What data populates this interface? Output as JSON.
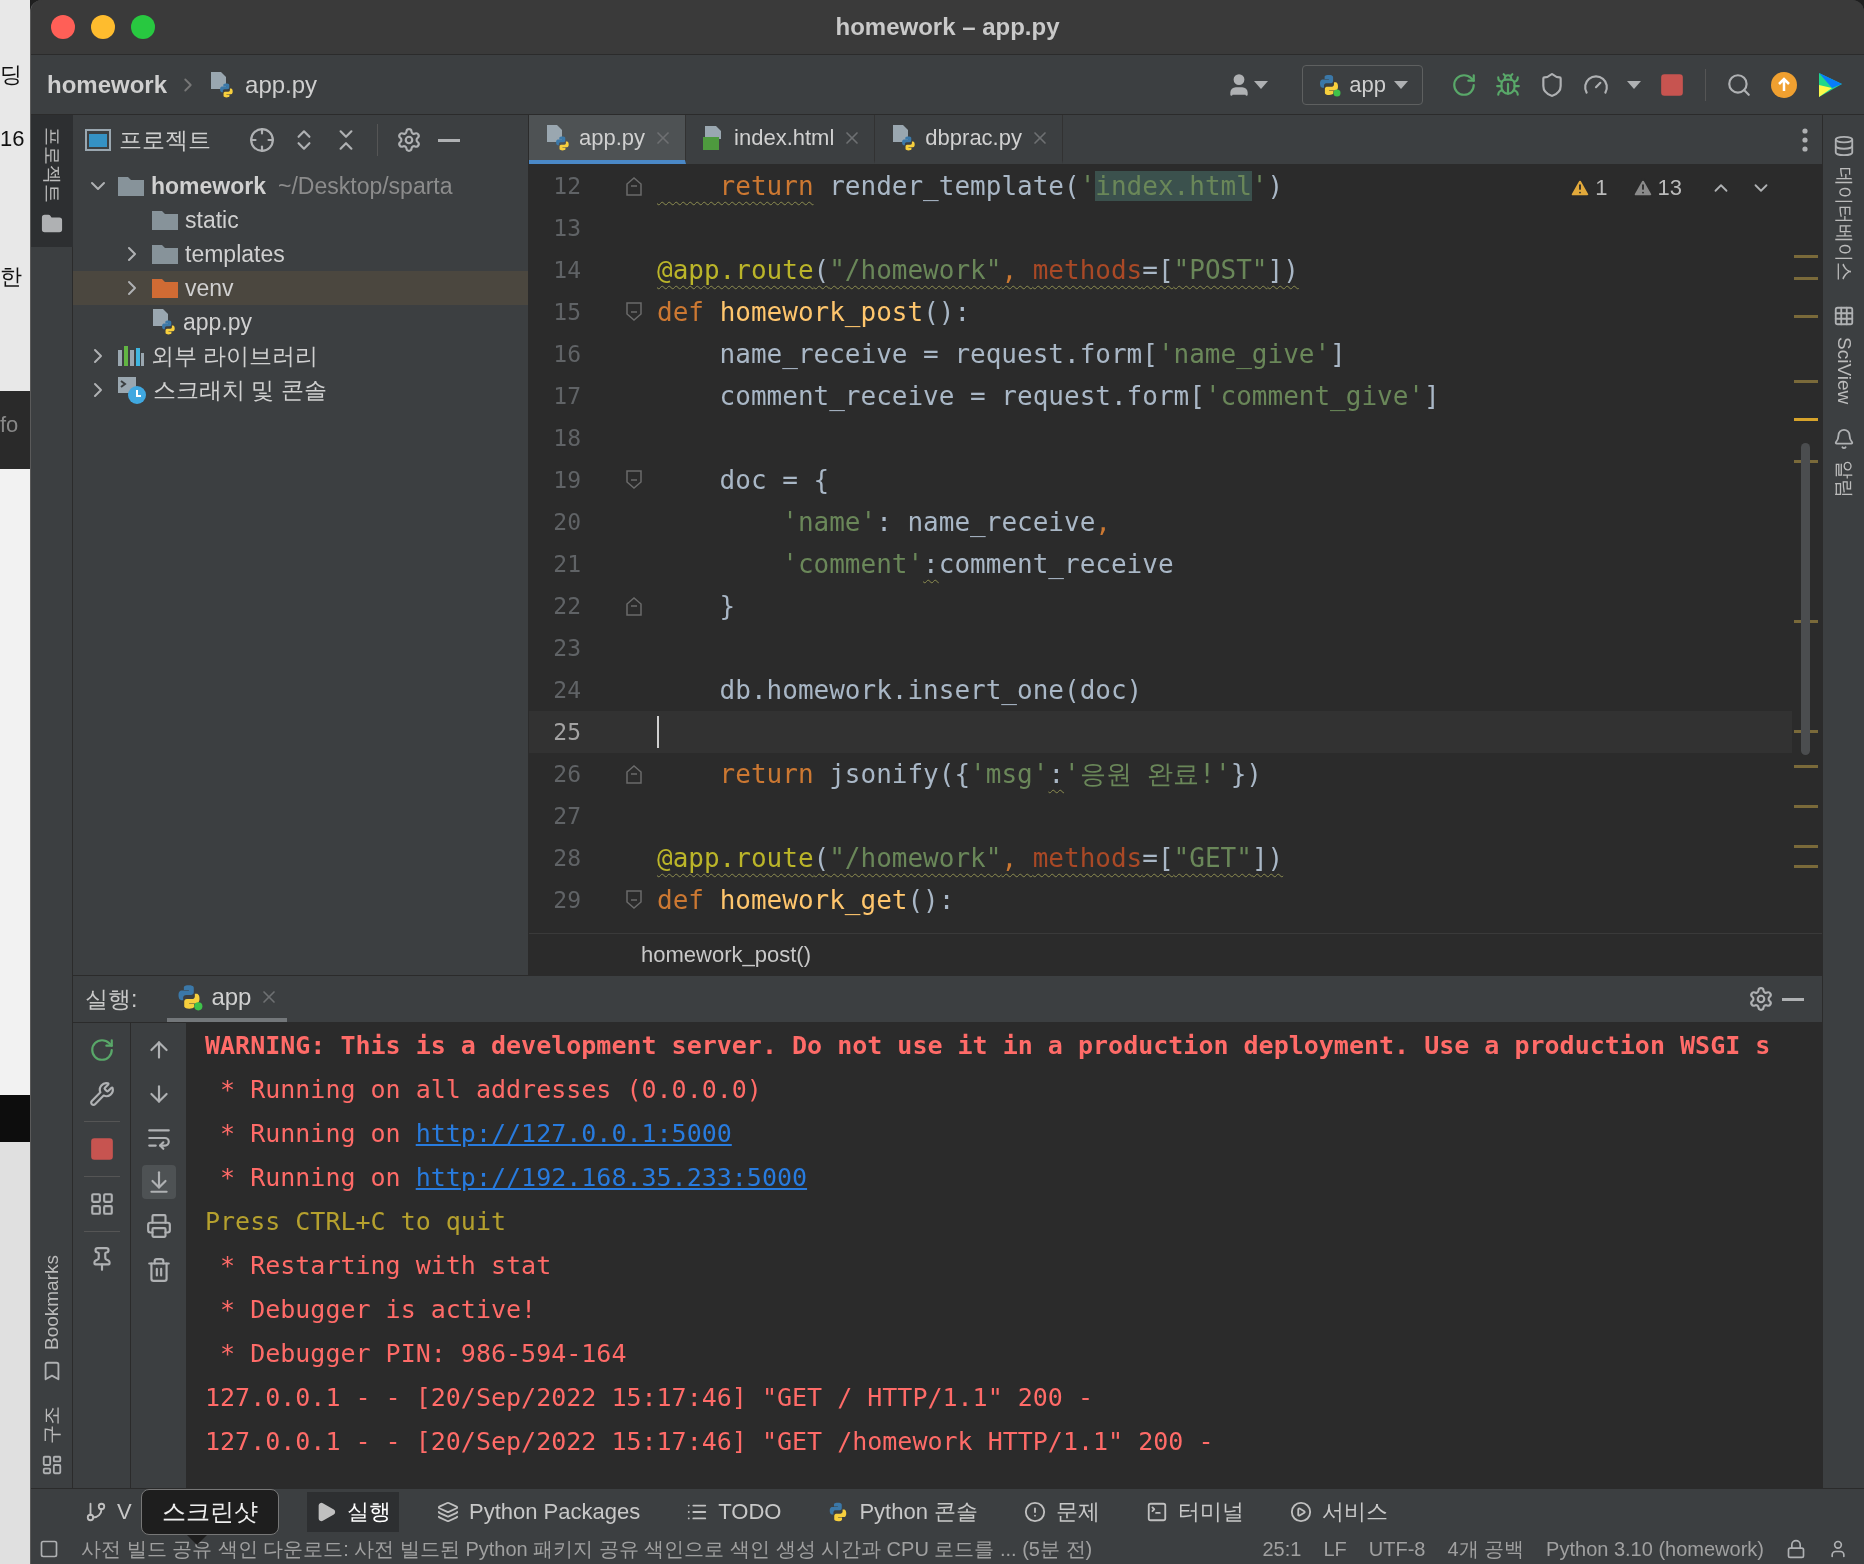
{
  "background_window": {
    "fragments": [
      "딩",
      "16",
      "한",
      "fo"
    ]
  },
  "window": {
    "title": "homework – app.py"
  },
  "nav": {
    "project": "homework",
    "file": "app.py",
    "run_config": "app"
  },
  "left_tool_strip": [
    {
      "label": "프로젝트",
      "kind": "project",
      "selected": true
    },
    {
      "label": "Bookmarks",
      "kind": "bookmarks",
      "selected": false
    },
    {
      "label": "구조",
      "kind": "structure",
      "selected": false
    }
  ],
  "project_panel": {
    "title": "프로젝트",
    "tree": [
      {
        "label": "homework",
        "kind": "folder",
        "path": "~/Desktop/sparta",
        "expanded": true,
        "selected": false,
        "children": [
          {
            "label": "static",
            "kind": "folder",
            "selected": false
          },
          {
            "label": "templates",
            "kind": "folder",
            "expanded": false,
            "selected": false
          },
          {
            "label": "venv",
            "kind": "excluded-folder",
            "expanded": false,
            "selected": true
          },
          {
            "label": "app.py",
            "kind": "python-file",
            "selected": false
          }
        ]
      },
      {
        "label": "외부 라이브러리",
        "kind": "library",
        "expanded": false,
        "selected": false
      },
      {
        "label": "스크래치 및 콘솔",
        "kind": "scratch",
        "expanded": false,
        "selected": false
      }
    ]
  },
  "tabs": [
    {
      "label": "app.py",
      "kind": "python",
      "selected": true
    },
    {
      "label": "index.html",
      "kind": "html",
      "selected": false
    },
    {
      "label": "dbprac.py",
      "kind": "python",
      "selected": false
    }
  ],
  "editor": {
    "inspections": {
      "warnings": "1",
      "weak_warnings": "13"
    },
    "lines": [
      {
        "no": "12",
        "fold_end": true,
        "tokens": [
          {
            "text": "    return",
            "kind": "keyword",
            "warn": true
          },
          {
            "text": " render_template(",
            "kind": "plain"
          },
          {
            "text": "'",
            "kind": "string"
          },
          {
            "text": "index.html",
            "kind": "matched-string"
          },
          {
            "text": "'",
            "kind": "string"
          },
          {
            "text": ")",
            "kind": "plain"
          }
        ]
      },
      {
        "no": "13"
      },
      {
        "no": "14",
        "tokens": [
          {
            "text": "@app.route",
            "kind": "decorator",
            "warn": true
          },
          {
            "text": "(",
            "kind": "plain",
            "warn": true
          },
          {
            "text": "\"/homework\"",
            "kind": "string",
            "warn": true
          },
          {
            "text": ", ",
            "kind": "keyword",
            "warn": true
          },
          {
            "text": "methods",
            "kind": "param",
            "warn": true
          },
          {
            "text": "=[",
            "kind": "plain",
            "warn": true
          },
          {
            "text": "\"POST\"",
            "kind": "string",
            "warn": true
          },
          {
            "text": "])",
            "kind": "plain",
            "warn": true
          }
        ]
      },
      {
        "no": "15",
        "fold_start": true,
        "tokens": [
          {
            "text": "def ",
            "kind": "keyword"
          },
          {
            "text": "homework_post",
            "kind": "func"
          },
          {
            "text": "():",
            "kind": "plain"
          }
        ]
      },
      {
        "no": "16",
        "tokens": [
          {
            "text": "    name_receive = request.form[",
            "kind": "plain"
          },
          {
            "text": "'name_give'",
            "kind": "string"
          },
          {
            "text": "]",
            "kind": "plain"
          }
        ]
      },
      {
        "no": "17",
        "tokens": [
          {
            "text": "    comment_receive = request.form[",
            "kind": "plain"
          },
          {
            "text": "'comment_give'",
            "kind": "string"
          },
          {
            "text": "]",
            "kind": "plain"
          }
        ]
      },
      {
        "no": "18"
      },
      {
        "no": "19",
        "fold_start": true,
        "tokens": [
          {
            "text": "    doc = {",
            "kind": "plain"
          }
        ]
      },
      {
        "no": "20",
        "tokens": [
          {
            "text": "        'name'",
            "kind": "string"
          },
          {
            "text": ": name_receive",
            "kind": "plain"
          },
          {
            "text": ",",
            "kind": "keyword"
          }
        ]
      },
      {
        "no": "21",
        "tokens": [
          {
            "text": "        'comment'",
            "kind": "string"
          },
          {
            "text": ":",
            "kind": "plain",
            "warn": true
          },
          {
            "text": "comment_receive",
            "kind": "plain"
          }
        ]
      },
      {
        "no": "22",
        "fold_end": true,
        "tokens": [
          {
            "text": "    }",
            "kind": "plain"
          }
        ]
      },
      {
        "no": "23"
      },
      {
        "no": "24",
        "tokens": [
          {
            "text": "    db.homework.insert_one(doc)",
            "kind": "plain"
          }
        ]
      },
      {
        "no": "25",
        "current": true
      },
      {
        "no": "26",
        "fold_end": true,
        "tokens": [
          {
            "text": "    return",
            "kind": "keyword"
          },
          {
            "text": " jsonify({",
            "kind": "plain"
          },
          {
            "text": "'msg'",
            "kind": "string"
          },
          {
            "text": ":",
            "kind": "plain",
            "warn": true
          },
          {
            "text": "'응원 완료!'",
            "kind": "string"
          },
          {
            "text": "})",
            "kind": "plain"
          }
        ]
      },
      {
        "no": "27"
      },
      {
        "no": "28",
        "tokens": [
          {
            "text": "@app.route",
            "kind": "decorator",
            "warn": true
          },
          {
            "text": "(",
            "kind": "plain",
            "warn": true
          },
          {
            "text": "\"/homework\"",
            "kind": "string",
            "warn": true
          },
          {
            "text": ", ",
            "kind": "keyword",
            "warn": true
          },
          {
            "text": "methods",
            "kind": "param",
            "warn": true
          },
          {
            "text": "=[",
            "kind": "plain",
            "warn": true
          },
          {
            "text": "\"GET\"",
            "kind": "string",
            "warn": true
          },
          {
            "text": "])",
            "kind": "plain",
            "warn": true
          }
        ]
      },
      {
        "no": "29",
        "fold_start": true,
        "tokens": [
          {
            "text": "def ",
            "kind": "keyword"
          },
          {
            "text": "homework_get",
            "kind": "func"
          },
          {
            "text": "():",
            "kind": "plain"
          }
        ]
      }
    ],
    "breadcrumb": "homework_post()"
  },
  "right_tool_strip": [
    {
      "label": "데이터베이스",
      "kind": "database"
    },
    {
      "label": "SciView",
      "kind": "sciview"
    },
    {
      "label": "알림",
      "kind": "notifications"
    }
  ],
  "run_panel": {
    "label": "실행:",
    "tab": "app",
    "scroll_to_end": true,
    "console": [
      {
        "kind": "warning",
        "text": "WARNING: This is a development server. Do not use it in a production deployment. Use a production WSGI s"
      },
      {
        "kind": "stderr",
        "text": " * Running on all addresses (0.0.0.0)"
      },
      {
        "kind": "stderr",
        "text": " * Running on ",
        "link": "http://127.0.0.1:5000"
      },
      {
        "kind": "stderr",
        "text": " * Running on ",
        "link": "http://192.168.35.233:5000"
      },
      {
        "kind": "info",
        "text": "Press CTRL+C to quit"
      },
      {
        "kind": "stderr",
        "text": " * Restarting with stat"
      },
      {
        "kind": "stderr",
        "text": " * Debugger is active!"
      },
      {
        "kind": "stderr",
        "text": " * Debugger PIN: 986-594-164"
      },
      {
        "kind": "stderr",
        "text": "127.0.0.1 - - [20/Sep/2022 15:17:46] \"GET / HTTP/1.1\" 200 -"
      },
      {
        "kind": "stderr",
        "text": "127.0.0.1 - - [20/Sep/2022 15:17:46] \"GET /homework HTTP/1.1\" 200 -"
      }
    ]
  },
  "tool_windows": [
    {
      "label": "V",
      "kind": "vcs",
      "selected": false
    },
    {
      "label": "실행",
      "kind": "run",
      "selected": true
    },
    {
      "label": "Python Packages",
      "kind": "packages",
      "selected": false
    },
    {
      "label": "TODO",
      "kind": "todo",
      "selected": false
    },
    {
      "label": "Python 콘솔",
      "kind": "python-console",
      "selected": false
    },
    {
      "label": "문제",
      "kind": "problems",
      "selected": false
    },
    {
      "label": "터미널",
      "kind": "terminal",
      "selected": false
    },
    {
      "label": "서비스",
      "kind": "services",
      "selected": false
    }
  ],
  "tooltip": "스크린샷",
  "status_bar": {
    "message": "사전 빌드 공유 색인 다운로드: 사전 빌드된 Python 패키지 공유 색인으로 색인 생성 시간과 CPU 로드를 ... (5분 전)",
    "items": [
      "25:1",
      "LF",
      "UTF-8",
      "4개 공백",
      "Python 3.10 (homework)"
    ]
  }
}
